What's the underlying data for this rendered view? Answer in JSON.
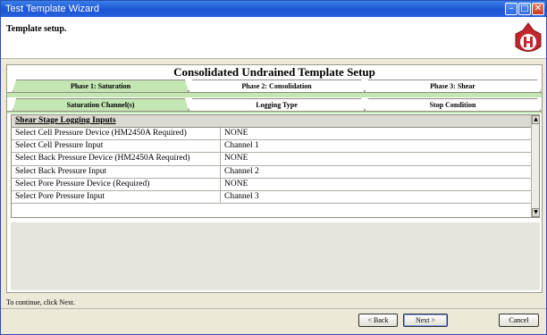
{
  "window": {
    "title": "Test Template Wizard"
  },
  "header": {
    "title": "Template setup."
  },
  "setup": {
    "title": "Consolidated Undrained Template Setup",
    "phase_tabs": [
      "Phase 1: Saturation",
      "Phase 2: Consolidation",
      "Phase 3: Shear"
    ],
    "sub_tabs": [
      "Saturation Channel(s)",
      "Logging Type",
      "Stop Condition"
    ]
  },
  "grid": {
    "section_header": "Shear Stage  Logging Inputs",
    "rows": [
      {
        "label": "Select Cell Pressure Device (HM2450A Required)",
        "value": "NONE"
      },
      {
        "label": "Select Cell Pressure Input",
        "value": "Channel 1"
      },
      {
        "label": "Select Back Pressure Device (HM2450A Required)",
        "value": "NONE"
      },
      {
        "label": "Select Back Pressure Input",
        "value": "Channel 2"
      },
      {
        "label": "Select Pore Pressure Device (Required)",
        "value": "NONE"
      },
      {
        "label": "Select Pore Pressure Input",
        "value": "Channel 3"
      }
    ]
  },
  "footer": {
    "hint": "To continue, click Next.",
    "back_label": "< Back",
    "next_label": "Next >",
    "cancel_label": "Cancel"
  },
  "colors": {
    "active_tab": "#c3e6b2",
    "titlebar": "#1b55d2",
    "logo": "#c0272d"
  },
  "icons": {
    "minimize": "minimize-icon",
    "maximize": "maximize-icon",
    "close": "close-icon",
    "logo": "h-logo-icon"
  }
}
